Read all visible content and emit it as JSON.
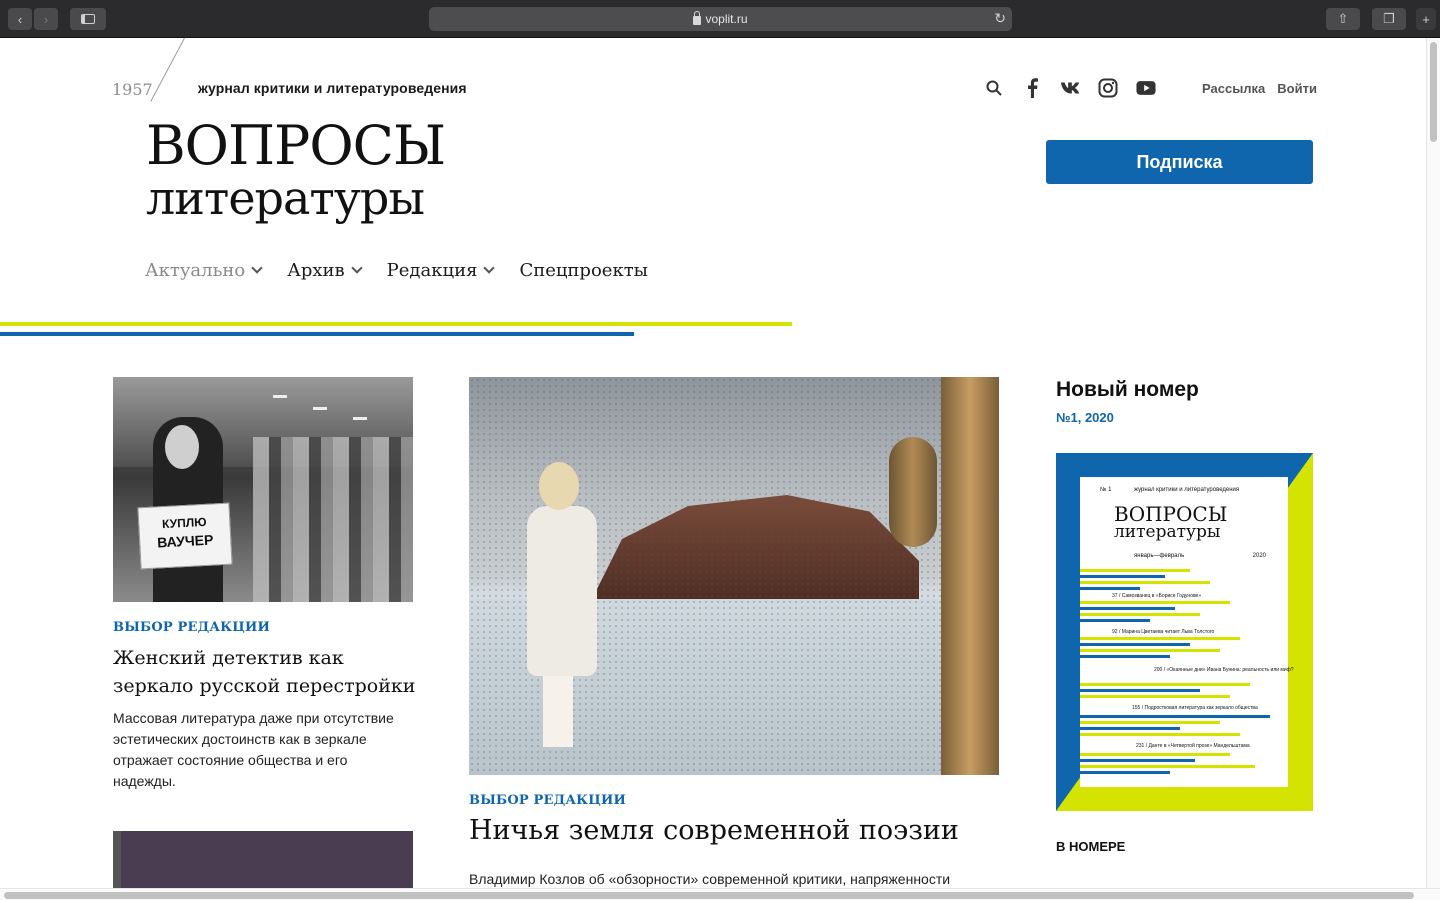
{
  "browser": {
    "url": "voplit.ru"
  },
  "header": {
    "year": "1957",
    "tagline": "журнал критики и литературоведения",
    "logo_line1": "ВОПРОСЫ",
    "logo_line2": "литературы",
    "social_icons": [
      "search-icon",
      "facebook-icon",
      "vk-icon",
      "instagram-icon",
      "youtube-icon"
    ],
    "newsletter_label": "Рассылка",
    "login_label": "Войти",
    "subscribe_label": "Подписка"
  },
  "nav": {
    "items": [
      {
        "label": "Актуально",
        "has_dropdown": true,
        "active": true
      },
      {
        "label": "Архив",
        "has_dropdown": true
      },
      {
        "label": "Редакция",
        "has_dropdown": true
      },
      {
        "label": "Спецпроекты",
        "has_dropdown": false
      }
    ]
  },
  "colors": {
    "accent_blue": "#0f66ad",
    "accent_yellow": "#d4e400"
  },
  "articles": [
    {
      "tag": "ВЫБОР РЕДАКЦИИ",
      "title": "Женский детектив как зеркало русской перестройки",
      "description": "Массовая литература даже при отсутствие эстетических достоинств как в зеркале отражает состояние общества и его надежды.",
      "image_sign_line1": "КУПЛЮ",
      "image_sign_line2": "ВАУЧЕР"
    },
    {
      "tag": "ВЫБОР РЕДАКЦИИ",
      "title": "Ничья земля современной поэзии",
      "description": "Владимир Козлов об «обзорности» современной критики, напряженности"
    }
  ],
  "sidebar": {
    "heading": "Новый номер",
    "issue_number": "№1, 2020",
    "cover": {
      "number": "№ 1",
      "tagline": "журнал критики и литературоведения",
      "title1": "ВОПРОСЫ",
      "title2": "литературы",
      "months": "январь—февраль",
      "year": "2020",
      "contents": [
        "37 / Самозванец в «Борисе Годунове»",
        "92 / Марина Цветаева читает Льва Толстого",
        "200 / «Окаянные дни» Ивана Бунина: реальность или миф?",
        "155 / Подростковая литература как зеркало общества",
        "231 / Данте в «Четвертой прозе» Мандельштама"
      ]
    },
    "in_issue_label": "В НОМЕРЕ"
  }
}
